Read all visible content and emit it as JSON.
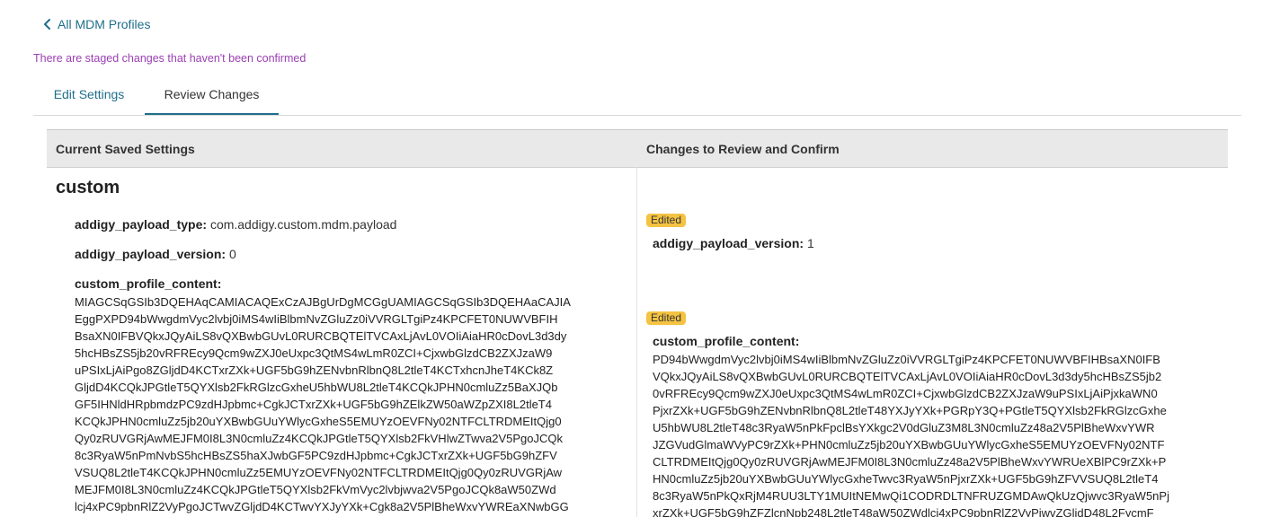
{
  "nav": {
    "back_label": "All MDM Profiles"
  },
  "notice": {
    "staged_changes": "There are staged changes that haven't been confirmed"
  },
  "tabs": [
    {
      "label": "Edit Settings",
      "active": false
    },
    {
      "label": "Review Changes",
      "active": true
    }
  ],
  "table": {
    "headers": {
      "current": "Current Saved Settings",
      "changes": "Changes to Review and Confirm"
    }
  },
  "current": {
    "section_title": "custom",
    "fields": [
      {
        "key": "addigy_payload_type:",
        "value": "com.addigy.custom.mdm.payload"
      },
      {
        "key": "addigy_payload_version:",
        "value": "0"
      },
      {
        "key": "custom_profile_content:",
        "value": ""
      }
    ],
    "profile_content_lines": [
      "MIAGCSqGSIb3DQEHAqCAMIACAQExCzAJBgUrDgMCGgUAMIAGCSqGSIb3DQEHAaCAJIA",
      "EggPXPD94bWwgdmVyc2lvbj0iMS4wIiBlbmNvZGluZz0iVVRGLTgiPz4KPCFET0NUWVBFIH",
      "BsaXN0IFBVQkxJQyAiLS8vQXBwbGUvL0RURCBQTElTVCAxLjAvL0VOIiAiaHR0cDovL3d3dy",
      "5hcHBsZS5jb20vRFREcy9Qcm9wZXJ0eUxpc3QtMS4wLmR0ZCI+CjxwbGlzdCB2ZXJzaW9",
      "uPSIxLjAiPgo8ZGljdD4KCTxrZXk+UGF5bG9hZENvbnRlbnQ8L2tleT4KCTxhcnJheT4KCk8Z",
      "GljdD4KCQkJPGtleT5QYXlsb2FkRGlzcGxheU5hbWU8L2tleT4KCQkJPHN0cmluZz5BaXJQb",
      "GF5IHNldHRpbmdzPC9zdHJpbmc+CgkJCTxrZXk+UGF5bG9hZElkZW50aWZpZXI8L2tleT4",
      "KCQkJPHN0cmluZz5jb20uYXBwbGUuYWlycGxheS5EMUYzOEVFNy02NTFCLTRDMEItQjg0",
      "Qy0zRUVGRjAwMEJFM0I8L3N0cmluZz4KCQkJPGtleT5QYXlsb2FkVHlwZTwva2V5PgoJCQk",
      "8c3RyaW5nPmNvbS5hcHBsZS5haXJwbGF5PC9zdHJpbmc+CgkJCTxrZXk+UGF5bG9hZFV",
      "VSUQ8L2tleT4KCQkJPHN0cmluZz5EMUYzOEVFNy02NTFCLTRDMEItQjg0Qy0zRUVGRjAw",
      "MEJFM0I8L3N0cmluZz4KCQkJPGtleT5QYXlsb2FkVmVyc2lvbjwva2V5PgoJCQk8aW50ZWd",
      "lcj4xPC9pbnRlZ2VyPgoJCTwvZGljdD4KCTwvYXJyYXk+Cgk8a2V5PlBheWxvYWREaXNwbGG"
    ]
  },
  "changes": {
    "badge_label": "Edited",
    "fields": [
      {
        "key": "addigy_payload_version:",
        "value": "1"
      },
      {
        "key": "custom_profile_content:",
        "value": ""
      }
    ],
    "profile_content_lines": [
      "PD94bWwgdmVyc2lvbj0iMS4wIiBlbmNvZGluZz0iVVRGLTgiPz4KPCFET0NUWVBFIHBsaXN0IFB",
      "VQkxJQyAiLS8vQXBwbGUvL0RURCBQTElTVCAxLjAvL0VOIiAiaHR0cDovL3d3dy5hcHBsZS5jb2",
      "0vRFREcy9Qcm9wZXJ0eUxpc3QtMS4wLmR0ZCI+CjxwbGlzdCB2ZXJzaW9uPSIxLjAiPjxkaWN0",
      "PjxrZXk+UGF5bG9hZENvbnRlbnQ8L2tleT48YXJyYXk+PGRpY3Q+PGtleT5QYXlsb2FkRGlzcGxhe",
      "U5hbWU8L2tleT48c3RyaW5nPkFpclBsYXkgc2V0dGluZ3M8L3N0cmluZz48a2V5PlBheWxvYWR",
      "JZGVudGlmaWVyPC9rZXk+PHN0cmluZz5jb20uYXBwbGUuYWlycGxheS5EMUYzOEVFNy02NTF",
      "CLTRDMEItQjg0Qy0zRUVGRjAwMEJFM0I8L3N0cmluZz48a2V5PlBheWxvYWRUeXBlPC9rZXk+P",
      "HN0cmluZz5jb20uYXBwbGUuYWlycGxheTwvc3RyaW5nPjxrZXk+UGF5bG9hZFVVSUQ8L2tleT4",
      "8c3RyaW5nPkQxRjM4RUU3LTY1MUItNEMwQi1CODRDLTNFRUZGMDAwQkUzQjwvc3RyaW5nPj",
      "xrZXk+UGF5bG9hZFZlcnNpb248L2tleT48aW50ZWdlcj4xPC9pbnRlZ2VyPjwvZGljdD48L2FycmF"
    ]
  },
  "colors": {
    "link": "#1f6f8b",
    "notice": "#9b3fb3",
    "badge": "#f5c342",
    "header_bg": "#e9e9e9"
  }
}
